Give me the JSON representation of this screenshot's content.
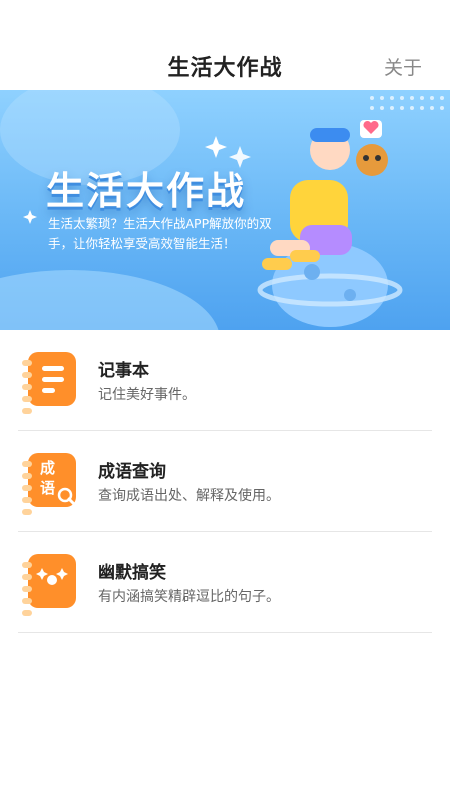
{
  "header": {
    "title": "生活大作战",
    "about_label": "关于"
  },
  "banner": {
    "title": "生活大作战",
    "subtitle": "生活太繁琐？生活大作战APP解放你的双手，让你轻松享受高效智能生活！"
  },
  "features": [
    {
      "title": "记事本",
      "subtitle": "记住美好事件。",
      "icon": "notebook-icon"
    },
    {
      "title": "成语查询",
      "subtitle": "查询成语出处、解释及使用。",
      "icon": "idiom-search-icon",
      "icon_text": [
        "成",
        "语"
      ]
    },
    {
      "title": "幽默搞笑",
      "subtitle": "有内涵搞笑精辟逗比的句子。",
      "icon": "clown-face-icon"
    }
  ],
  "colors": {
    "accent": "#ff8f2a",
    "banner_blue": "#69b7f6"
  }
}
